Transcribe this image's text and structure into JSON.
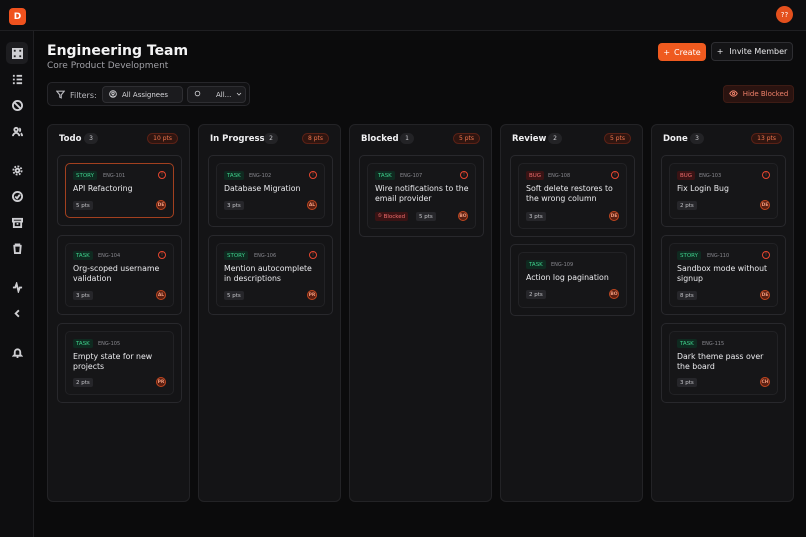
{
  "app": {
    "logo_letter": "D",
    "user_initials": "??"
  },
  "header": {
    "title": "Engineering Team",
    "subtitle": "Core Product Development",
    "create_label": "Create",
    "invite_label": "Invite Member"
  },
  "filters": {
    "label": "Filters:",
    "assignees": "All Assignees",
    "second": "All..."
  },
  "hide_blocked_label": "Hide Blocked",
  "columns": [
    {
      "name": "Todo",
      "count": "3",
      "points": "10 pts",
      "cards": [
        {
          "type": "STORY",
          "key": "ENG-101",
          "title": "API Refactoring",
          "points": "5 pts",
          "assignee": "DE"
        },
        {
          "type": "TASK",
          "key": "ENG-104",
          "title": "Org-scoped username validation",
          "points": "3 pts",
          "assignee": "AL"
        },
        {
          "type": "TASK",
          "key": "ENG-105",
          "title": "Empty state for new projects",
          "points": "2 pts",
          "assignee": "PR"
        }
      ]
    },
    {
      "name": "In Progress",
      "count": "2",
      "points": "8 pts",
      "cards": [
        {
          "type": "TASK",
          "key": "ENG-102",
          "title": "Database Migration",
          "points": "3 pts",
          "assignee": "AL"
        },
        {
          "type": "STORY",
          "key": "ENG-106",
          "title": "Mention autocomplete in descriptions",
          "points": "5 pts",
          "assignee": "PR"
        }
      ]
    },
    {
      "name": "Blocked",
      "count": "1",
      "points": "5 pts",
      "cards": [
        {
          "type": "TASK",
          "key": "ENG-107",
          "title": "Wire notifications to the email provider",
          "blocked": "Blocked",
          "points": "5 pts",
          "assignee": "BO"
        }
      ]
    },
    {
      "name": "Review",
      "count": "2",
      "points": "5 pts",
      "cards": [
        {
          "type": "BUG",
          "key": "ENG-108",
          "title": "Soft delete restores to the wrong column",
          "points": "3 pts",
          "assignee": "DE"
        },
        {
          "type": "TASK",
          "key": "ENG-109",
          "title": "Action log pagination",
          "points": "2 pts",
          "assignee": "BO"
        }
      ]
    },
    {
      "name": "Done",
      "count": "3",
      "points": "13 pts",
      "cards": [
        {
          "type": "BUG",
          "key": "ENG-103",
          "title": "Fix Login Bug",
          "points": "2 pts",
          "assignee": "DE"
        },
        {
          "type": "STORY",
          "key": "ENG-110",
          "title": "Sandbox mode without signup",
          "points": "8 pts",
          "assignee": "DE"
        },
        {
          "type": "TASK",
          "key": "ENG-115",
          "title": "Dark theme pass over the board",
          "points": "3 pts",
          "assignee": "CH"
        }
      ]
    }
  ],
  "colors": {
    "accent": "#ef5a1f",
    "tag_green": "#3fd18c",
    "tag_red": "#f06d6d"
  }
}
